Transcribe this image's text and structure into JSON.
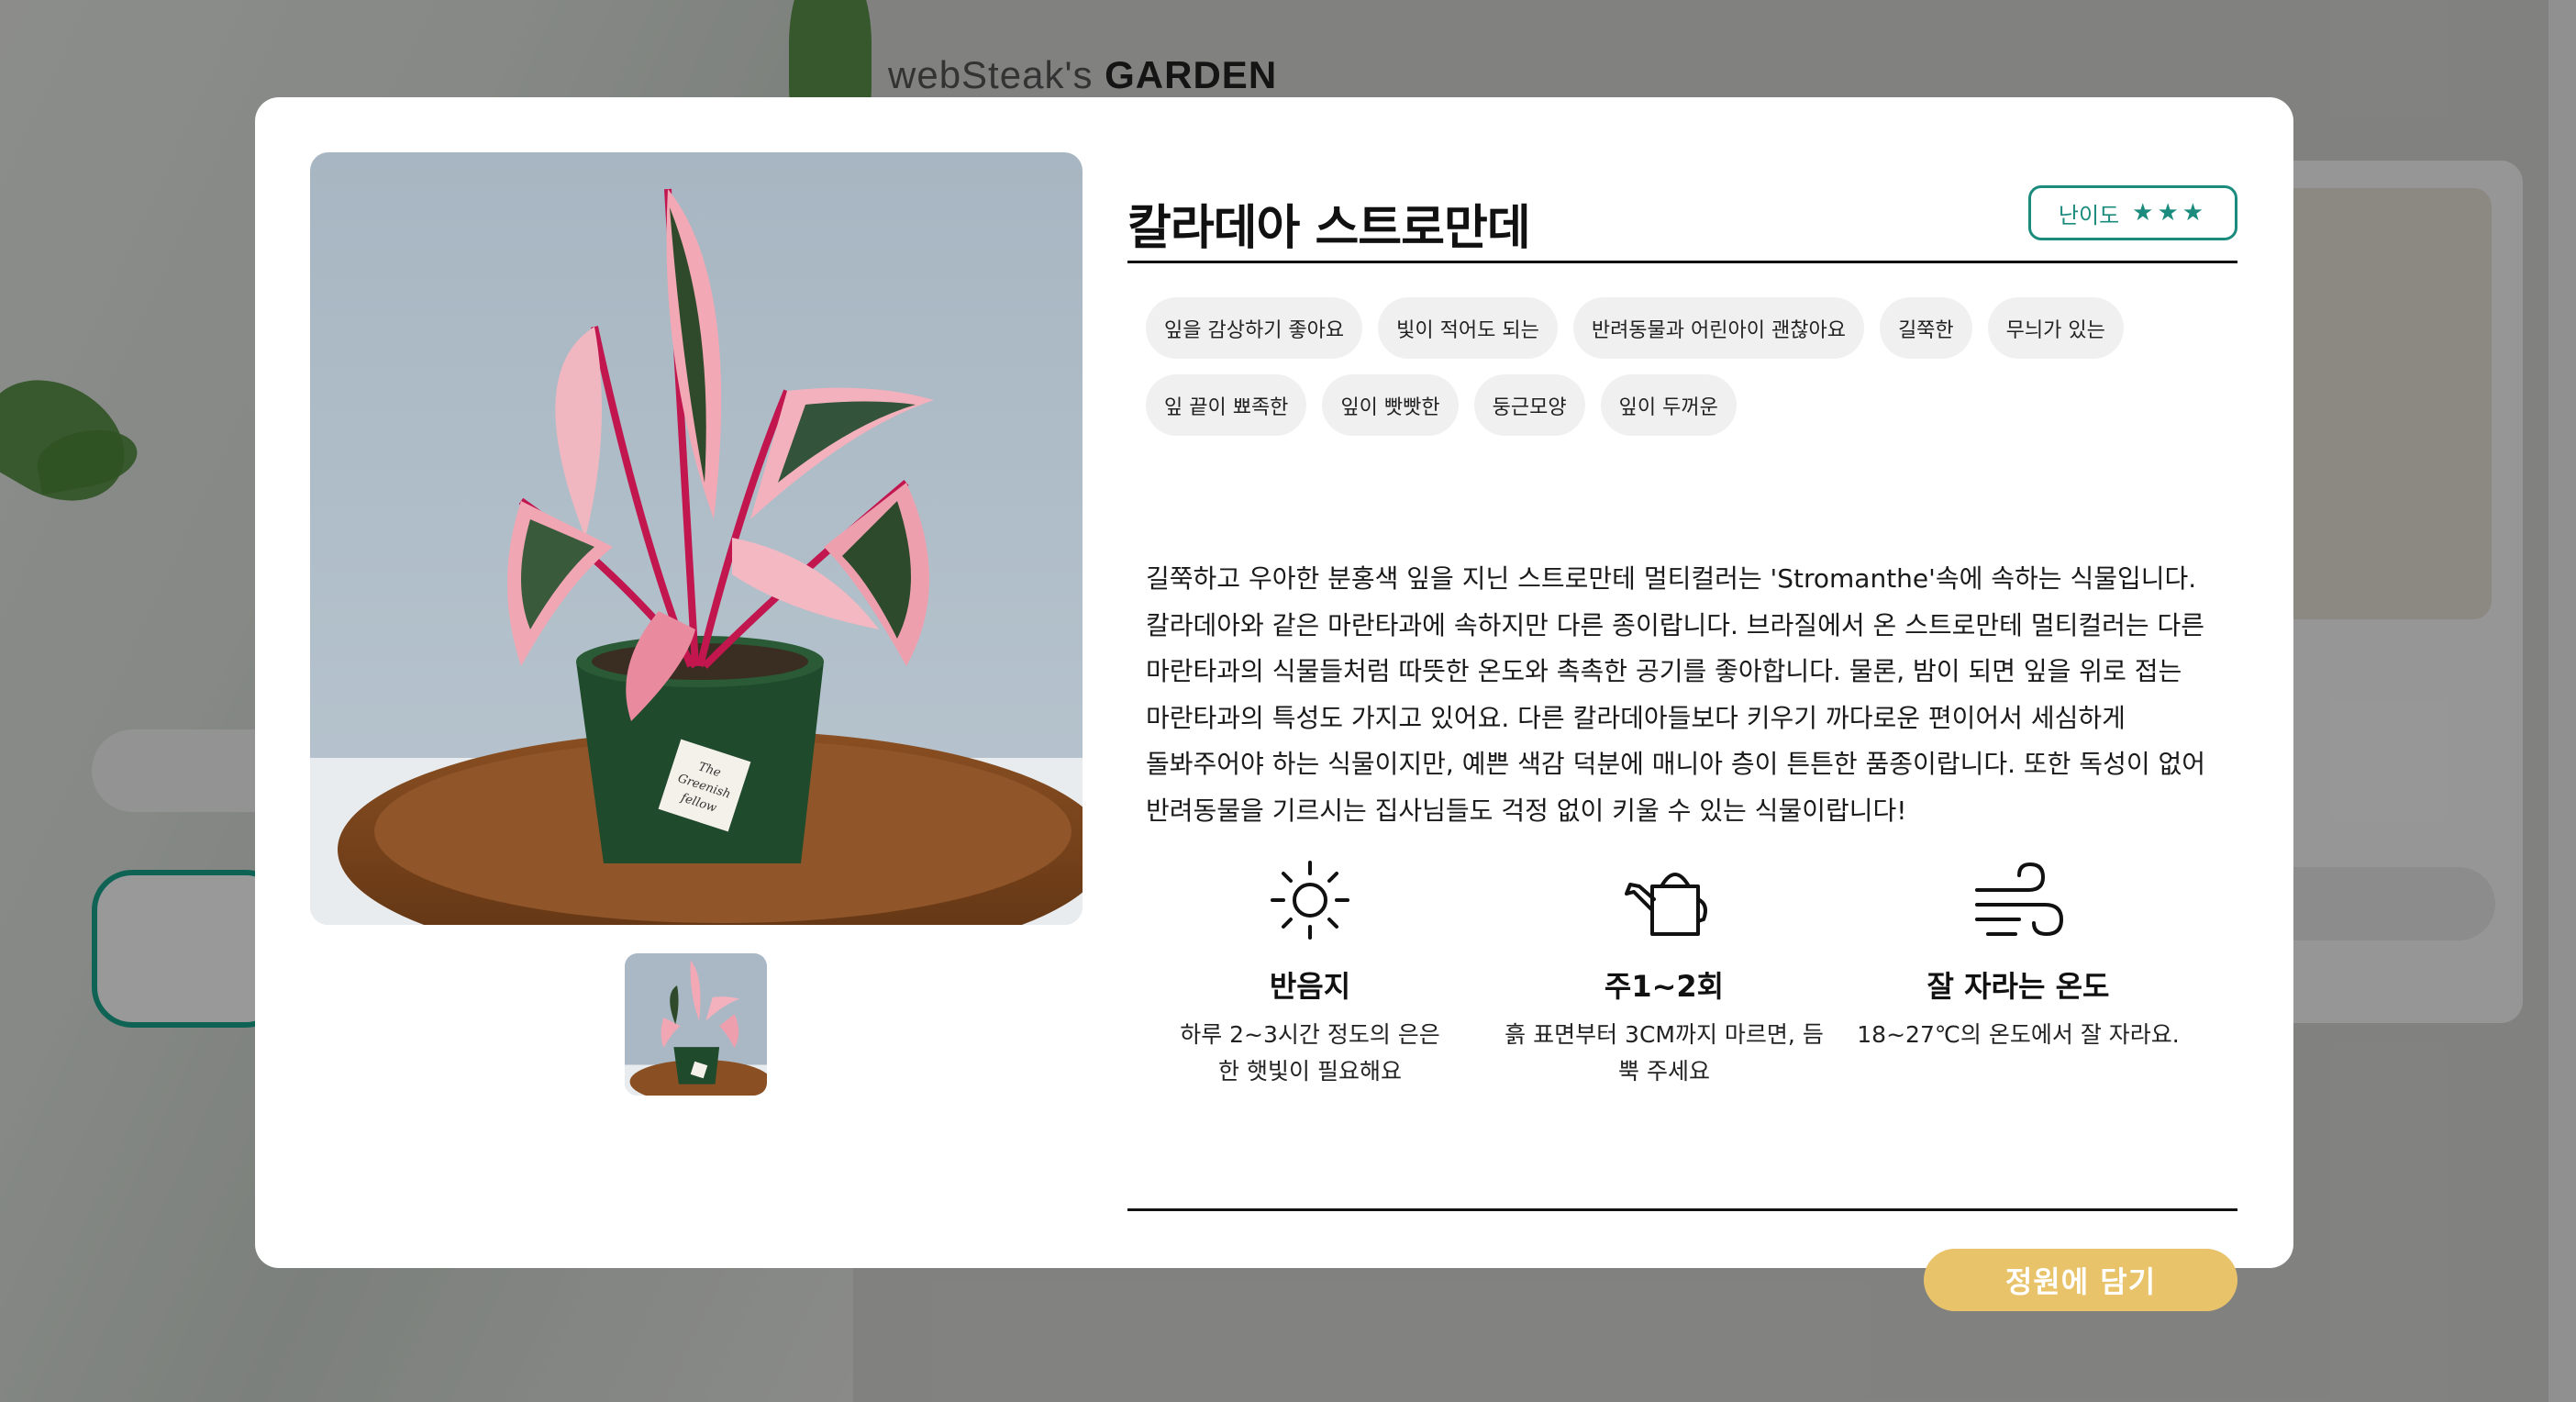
{
  "background": {
    "logo_light": "webSteak's",
    "logo_bold": "GARDEN"
  },
  "modal": {
    "title": "칼라데아 스트로만데",
    "difficulty_label": "난이도",
    "difficulty_stars": "★★★",
    "tags": [
      "잎을 감상하기 좋아요",
      "빛이 적어도 되는",
      "반려동물과 어린아이 괜찮아요",
      "길쭉한",
      "무늬가 있는",
      "잎 끝이 뾰족한",
      "잎이 빳빳한",
      "둥근모양",
      "잎이 두꺼운"
    ],
    "description": "길쭉하고 우아한 분홍색 잎을 지닌 스트로만테 멀티컬러는 'Stromanthe'속에 속하는 식물입니다. 칼라데아와 같은 마란타과에 속하지만 다른 종이랍니다. 브라질에서 온 스트로만테 멀티컬러는 다른 마란타과의 식물들처럼 따뜻한 온도와 촉촉한 공기를 좋아합니다. 물론, 밤이 되면 잎을 위로 접는 마란타과의 특성도 가지고 있어요. 다른 칼라데아들보다 키우기 까다로운 편이어서 세심하게 돌봐주어야 하는 식물이지만, 예쁜 색감 덕분에 매니아 층이 튼튼한 품종이랍니다. 또한 독성이 없어 반려동물을 기르시는 집사님들도 걱정 없이 키울 수 있는 식물이랍니다!",
    "care": [
      {
        "icon": "sun-icon",
        "title": "반음지",
        "text": "하루 2~3시간 정도의 은은한 햇빛이 필요해요"
      },
      {
        "icon": "watering-can-icon",
        "title": "주1~2회",
        "text": "흙 표면부터 3CM까지 마르면, 듬뿍 주세요"
      },
      {
        "icon": "wind-icon",
        "title": "잘 자라는 온도",
        "text": "18~27℃의 온도에서 잘 자라요."
      }
    ],
    "add_button_label": "정원에 담기",
    "pot_label": "The Greenish fellow",
    "colors": {
      "accent_teal": "#1b8b7d",
      "button_gold": "#e8c36a"
    }
  }
}
